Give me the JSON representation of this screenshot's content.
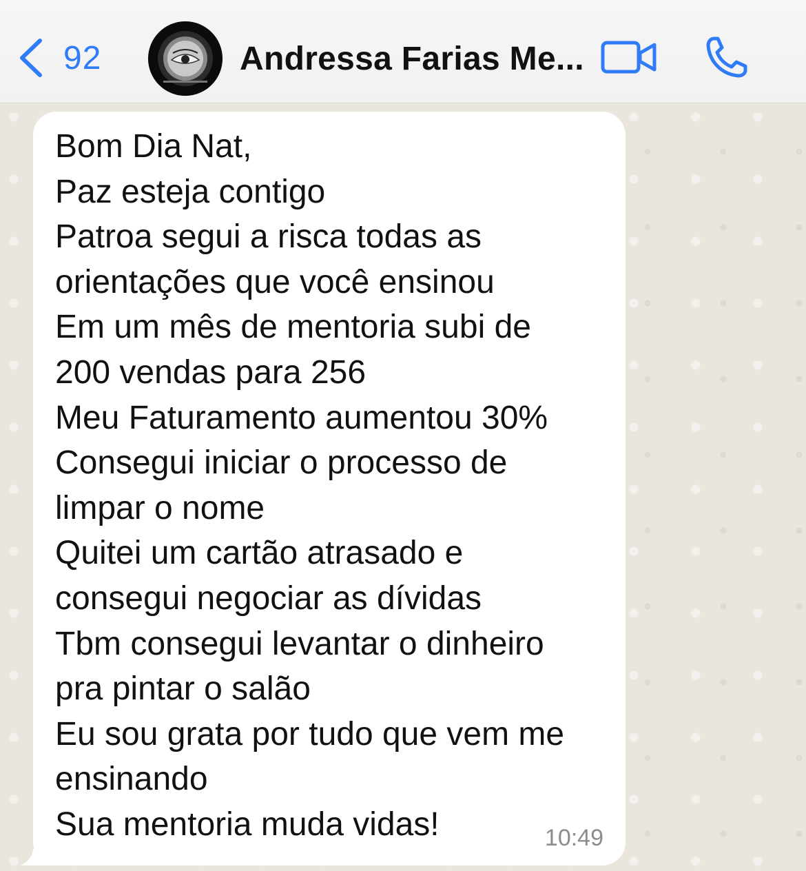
{
  "header": {
    "back_count": "92",
    "contact_name": "Andressa Farias Me..."
  },
  "icons": {
    "back": "chevron-left-icon",
    "video": "video-camera-icon",
    "call": "phone-icon"
  },
  "colors": {
    "accent": "#2f7cf6",
    "bubble": "#ffffff",
    "wallpaper": "#eae6de"
  },
  "message": {
    "lines": [
      "Bom Dia Nat,",
      "Paz esteja contigo",
      "Patroa segui a risca todas as",
      "orientações que você ensinou",
      "Em um mês de mentoria subi de",
      "200 vendas para 256",
      "Meu Faturamento aumentou 30%",
      "Consegui iniciar o processo de",
      "limpar o nome",
      "Quitei um cartão atrasado e",
      "consegui negociar as dívidas",
      "Tbm consegui levantar o dinheiro",
      "pra pintar o salão",
      "Eu sou grata por tudo que vem me",
      "ensinando",
      "Sua mentoria muda vidas!"
    ],
    "time": "10:49"
  }
}
